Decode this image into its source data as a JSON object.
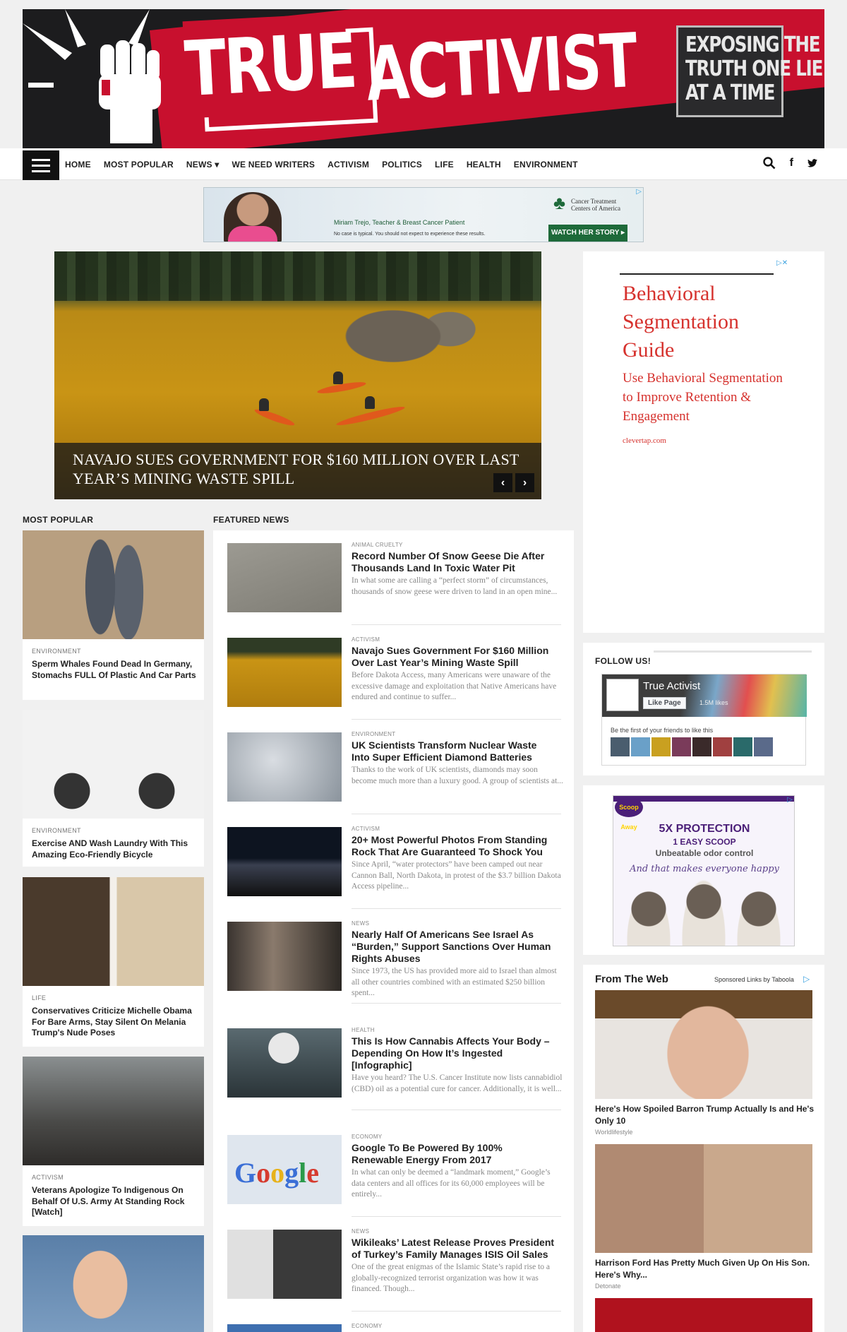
{
  "header": {
    "logo_true": "TRUE",
    "logo_activist": "ACTIVIST",
    "tagline": [
      "EXPOSING THE",
      "TRUTH ONE LIE",
      "AT A TIME"
    ]
  },
  "nav": {
    "items": [
      "HOME",
      "MOST POPULAR",
      "NEWS ▾",
      "WE NEED WRITERS",
      "ACTIVISM",
      "POLITICS",
      "LIFE",
      "HEALTH",
      "ENVIRONMENT"
    ],
    "icons": [
      "search-icon",
      "facebook-icon",
      "twitter-icon"
    ],
    "icon_glyphs": [
      "⚲",
      "f",
      "🐦"
    ]
  },
  "top_ad": {
    "caption": "Miriam Trejo, Teacher & Breast Cancer Patient",
    "disclaimer": "No case is typical. You should not expect to experience these results.",
    "brand": [
      "Cancer Treatment",
      "Centers of America"
    ],
    "cta": "WATCH HER STORY ▸"
  },
  "hero": {
    "title": "NAVAJO SUES GOVERNMENT FOR $160 MILLION OVER LAST YEAR’S MINING WASTE SPILL",
    "prev": "‹",
    "next": "›"
  },
  "sidebar": {
    "ad1": {
      "title": "Behavioral Segmentation Guide",
      "subtitle": "Use Behavioral Segmentation to Improve Retention & Engagement",
      "source": "clevertap.com"
    },
    "follow": {
      "heading": "FOLLOW US!",
      "page_name": "True Activist",
      "like_label": "Like Page",
      "likes": "1.5M likes",
      "friends_text": "Be the first of your friends to like this"
    },
    "ad2": {
      "logo": "Scoop Away",
      "line1": "5X PROTECTION",
      "line2": "1 EASY SCOOP",
      "line3": "Unbeatable odor control",
      "line4": "And that makes everyone happy"
    },
    "from_web": {
      "heading": "From The Web",
      "sponsored": "Sponsored Links by Taboola",
      "items": [
        {
          "title": "Here's How Spoiled Barron Trump Actually Is and He's Only 10",
          "source": "Worldlifestyle"
        },
        {
          "title": "Harrison Ford Has Pretty Much Given Up On His Son. Here's Why...",
          "source": "Detonate"
        }
      ]
    }
  },
  "most_popular": {
    "heading": "MOST POPULAR",
    "items": [
      {
        "category": "ENVIRONMENT",
        "title": "Sperm Whales Found Dead In Germany, Stomachs FULL Of Plastic And Car Parts"
      },
      {
        "category": "ENVIRONMENT",
        "title": "Exercise AND Wash Laundry With This Amazing Eco-Friendly Bicycle"
      },
      {
        "category": "LIFE",
        "title": "Conservatives Criticize Michelle Obama For Bare Arms, Stay Silent On Melania Trump's Nude Poses"
      },
      {
        "category": "ACTIVISM",
        "title": "Veterans Apologize To Indigenous On Behalf Of U.S. Army At Standing Rock [Watch]"
      }
    ]
  },
  "featured": {
    "heading": "FEATURED NEWS",
    "items": [
      {
        "category": "ANIMAL CRUELTY",
        "title": "Record Number Of Snow Geese Die After Thousands Land In Toxic Water Pit",
        "excerpt": "In what some are calling a “perfect storm” of circumstances, thousands of snow geese were driven to land in an open mine..."
      },
      {
        "category": "ACTIVISM",
        "title": "Navajo Sues Government For $160 Million Over Last Year’s Mining Waste Spill",
        "excerpt": "Before Dakota Access, many Americans were unaware of the excessive damage and exploitation that Native Americans have endured and continue to suffer..."
      },
      {
        "category": "ENVIRONMENT",
        "title": "UK Scientists Transform Nuclear Waste Into Super Efficient Diamond Batteries",
        "excerpt": "Thanks to the work of UK scientists, diamonds may soon become much more than a luxury good. A group of scientists at..."
      },
      {
        "category": "ACTIVISM",
        "title": "20+ Most Powerful Photos From Standing Rock That Are Guaranteed To Shock You",
        "excerpt": "Since April, “water protectors” have been camped out near Cannon Ball, North Dakota, in protest of the $3.7 billion Dakota Access pipeline..."
      },
      {
        "category": "NEWS",
        "title": "Nearly Half Of Americans See Israel As “Burden,” Support Sanctions Over Human Rights Abuses",
        "excerpt": "Since 1973, the US has provided more aid to Israel than almost all other countries combined with an estimated $250 billion spent..."
      },
      {
        "category": "HEALTH",
        "title": "This Is How Cannabis Affects Your Body – Depending On How It’s Ingested [Infographic]",
        "excerpt": "Have you heard? The U.S. Cancer Institute now lists cannabidiol (CBD) oil as a potential cure for cancer. Additionally, it is well..."
      },
      {
        "category": "ECONOMY",
        "title": "Google To Be Powered By 100% Renewable Energy From 2017",
        "excerpt": "In what can only be deemed a “landmark moment,” Google’s data centers and all offices for its 60,000 employees will be entirely..."
      },
      {
        "category": "NEWS",
        "title": "Wikileaks’ Latest Release Proves President of Turkey’s Family Manages ISIS Oil Sales",
        "excerpt": "One of the great enigmas of the Islamic State’s rapid rise to a globally-recognized terrorist organization was how it was financed. Though..."
      },
      {
        "category": "ECONOMY",
        "title": "",
        "excerpt": ""
      }
    ]
  },
  "colors": {
    "brand_red": "#c8102e",
    "banner_dark": "#1c1c1e",
    "ad_red": "#d6322e"
  }
}
